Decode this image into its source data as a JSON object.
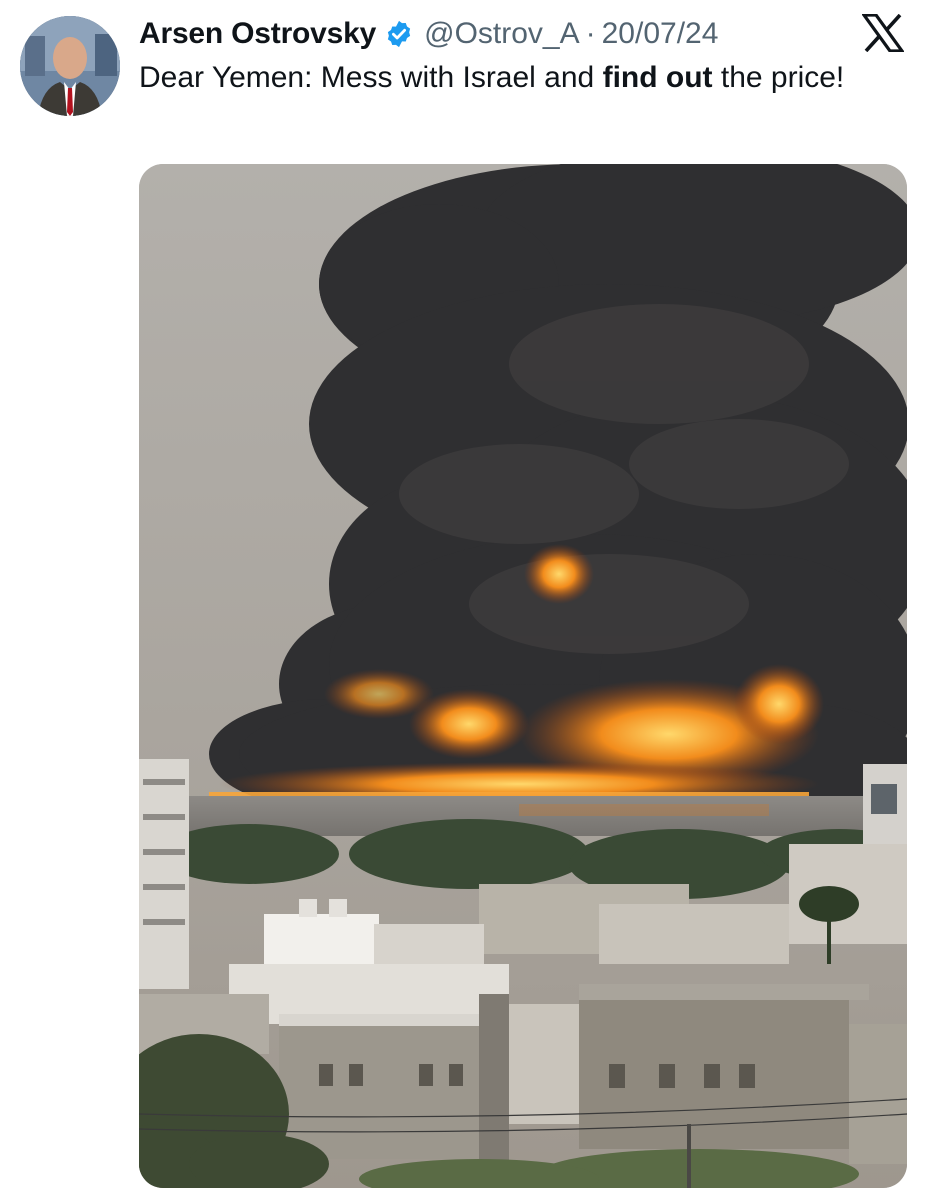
{
  "author": {
    "display_name": "Arsen Ostrovsky",
    "handle": "@Ostrov_A",
    "separator": "·",
    "date": "20/07/24",
    "verified": true,
    "verified_icon": "verified-badge-icon",
    "avatar": "profile-photo"
  },
  "platform": {
    "logo": "x-logo-icon"
  },
  "tweet": {
    "text_before": "Dear Yemen: Mess with Israel and ",
    "text_bold": "find out",
    "text_after": " the price!"
  },
  "media": {
    "type": "photo",
    "subject": "large fire with black smoke plume over port, city buildings in foreground"
  },
  "colors": {
    "text": "#0f1419",
    "secondary_text": "#536471",
    "verified_blue": "#1d9bf0",
    "fire_orange": "#f28c1c",
    "smoke": "#2f2f31"
  }
}
